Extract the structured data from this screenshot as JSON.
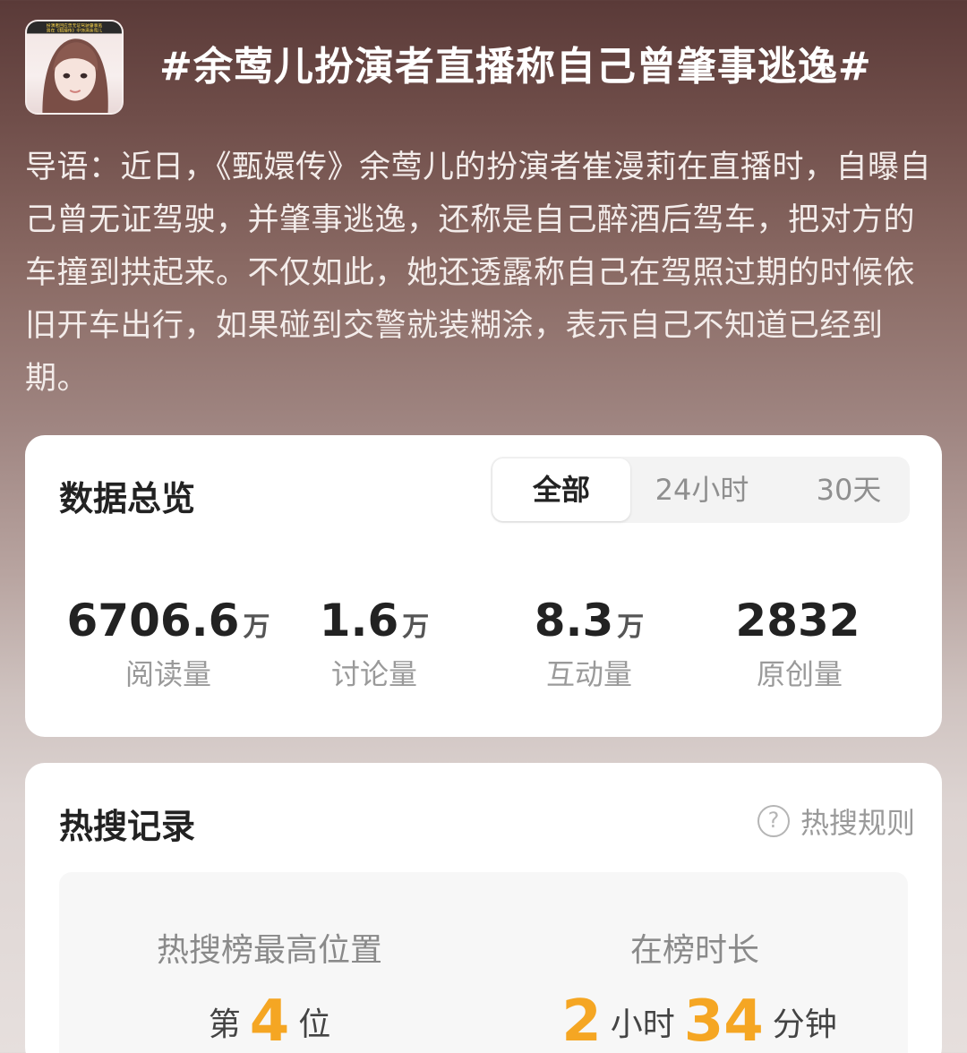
{
  "topic": {
    "title": "#余莺儿扮演者直播称自己曾肇事逃逸#",
    "avatar_caption_line1": "扮演者回应曾无证驾驶肇事逃",
    "avatar_caption_line2": "曾在《甄嬛传》中饰演余莺儿"
  },
  "intro": "导语：近日，《甄嬛传》余莺儿的扮演者崔漫莉在直播时，自曝自己曾无证驾驶，并肇事逃逸，还称是自己醉酒后驾车，把对方的车撞到拱起来。不仅如此，她还透露称自己在驾照过期的时候依旧开车出行，如果碰到交警就装糊涂，表示自己不知道已经到期。",
  "overview": {
    "title": "数据总览",
    "tabs": [
      "全部",
      "24小时",
      "30天"
    ],
    "stats": [
      {
        "value": "6706.6",
        "unit": "万",
        "label": "阅读量"
      },
      {
        "value": "1.6",
        "unit": "万",
        "label": "讨论量"
      },
      {
        "value": "8.3",
        "unit": "万",
        "label": "互动量"
      },
      {
        "value": "2832",
        "unit": "",
        "label": "原创量"
      }
    ]
  },
  "hot": {
    "title": "热搜记录",
    "rules_label": "热搜规则",
    "help_icon_glyph": "?",
    "peak_label": "热搜榜最高位置",
    "peak_prefix": "第",
    "peak_value": "4",
    "peak_suffix": "位",
    "duration_label": "在榜时长",
    "duration_hours": "2",
    "duration_hours_unit": "小时",
    "duration_minutes": "34",
    "duration_minutes_unit": "分钟"
  },
  "colors": {
    "accent": "#f5a623",
    "card_bg": "#ffffff"
  }
}
